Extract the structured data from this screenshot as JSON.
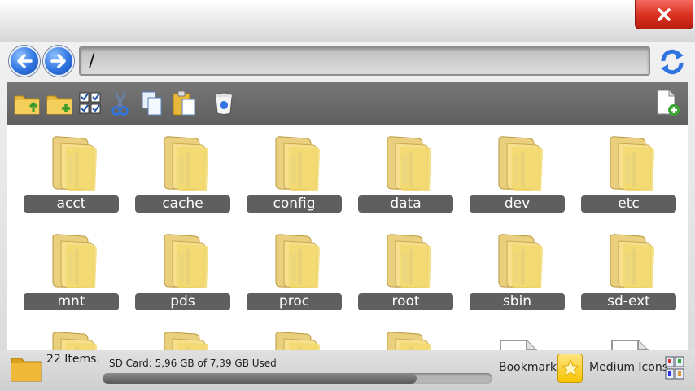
{
  "window": {
    "close_icon": "close-x-icon"
  },
  "navigation": {
    "back_icon": "arrow-left-icon",
    "forward_icon": "arrow-right-icon",
    "path": "/",
    "refresh_icon": "refresh-icon"
  },
  "toolbar": {
    "tools": [
      {
        "name": "folder-up-icon"
      },
      {
        "name": "new-folder-icon"
      },
      {
        "name": "select-all-icon"
      },
      {
        "name": "cut-icon"
      },
      {
        "name": "copy-icon"
      },
      {
        "name": "paste-icon"
      },
      {
        "name": "delete-icon"
      }
    ],
    "new_file_icon": "new-file-icon"
  },
  "folders": [
    {
      "label": "acct"
    },
    {
      "label": "cache"
    },
    {
      "label": "config"
    },
    {
      "label": "data"
    },
    {
      "label": "dev"
    },
    {
      "label": "etc"
    },
    {
      "label": "mnt"
    },
    {
      "label": "pds"
    },
    {
      "label": "proc"
    },
    {
      "label": "root"
    },
    {
      "label": "sbin"
    },
    {
      "label": "sd-ext"
    }
  ],
  "status": {
    "items": "22 Items.",
    "sd_card": "SD Card: 5,96 GB of 7,39 GB Used",
    "sd_used_fraction": 0.806,
    "bookmarks": "Bookmarks",
    "view_mode": "Medium Icons"
  },
  "colors": {
    "close": "#d9301f",
    "nav_blue": "#2f74e0",
    "folder": "#f2d479",
    "label_bg": "#5f5f5f"
  }
}
